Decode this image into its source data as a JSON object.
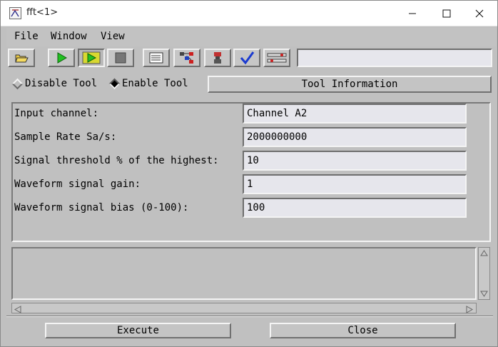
{
  "window": {
    "title": "fft<1>",
    "minimize_glyph": "—",
    "maximize_glyph": "☐",
    "close_glyph": "✕"
  },
  "menu": {
    "items": [
      "File",
      "Window",
      "View"
    ]
  },
  "toolbar": {
    "buttons": [
      {
        "icon": "open-folder-icon"
      },
      {
        "icon": "run-icon"
      },
      {
        "icon": "run-step-icon"
      },
      {
        "icon": "stop-icon"
      },
      {
        "icon": "list-icon"
      },
      {
        "icon": "network-icon"
      },
      {
        "icon": "probe-icon"
      },
      {
        "icon": "checkmark-icon"
      },
      {
        "icon": "tools-icon"
      }
    ],
    "status_text": ""
  },
  "mode": {
    "disable_label": "Disable Tool",
    "enable_label": "Enable Tool",
    "selected": "enable"
  },
  "tool_info_label": "Tool Information",
  "params": [
    {
      "label": "Input channel:",
      "value": "Channel A2"
    },
    {
      "label": "Sample Rate Sa/s:",
      "value": "2000000000"
    },
    {
      "label": "Signal threshold % of the highest:",
      "value": "10"
    },
    {
      "label": "Waveform signal gain:",
      "value": "1"
    },
    {
      "label": "Waveform signal bias (0-100):",
      "value": "100"
    }
  ],
  "output_text": "",
  "actions": {
    "execute_label": "Execute",
    "close_label": "Close"
  }
}
